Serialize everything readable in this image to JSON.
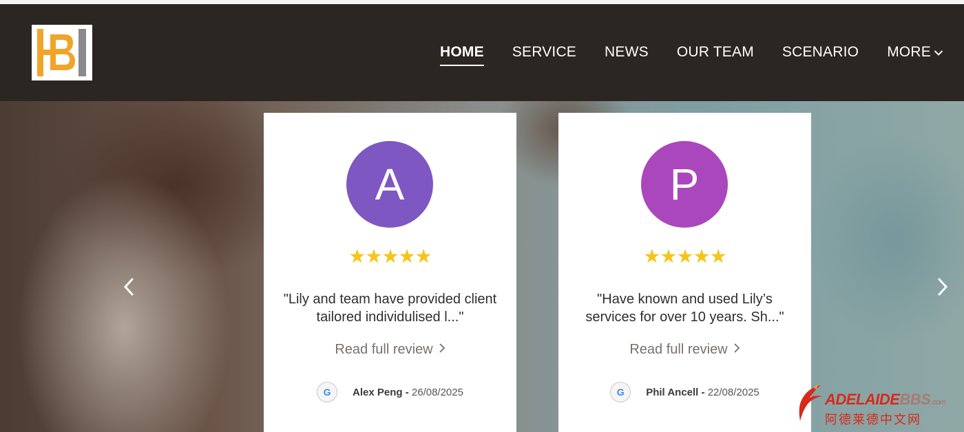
{
  "header": {
    "logo_text": "HB",
    "nav": [
      {
        "label": "HOME",
        "active": true
      },
      {
        "label": "SERVICE",
        "active": false
      },
      {
        "label": "NEWS",
        "active": false
      },
      {
        "label": "OUR TEAM",
        "active": false
      },
      {
        "label": "SCENARIO",
        "active": false
      },
      {
        "label": "MORE",
        "active": false,
        "icon": "chevron-down-icon"
      }
    ]
  },
  "carousel": {
    "prev_icon": "chevron-left-icon",
    "next_icon": "chevron-right-icon",
    "reviews": [
      {
        "avatar_letter": "A",
        "avatar_color": "#7e57c2",
        "rating": 5,
        "stars": "★★★★★",
        "quote": "\"Lily and team have provided client tailored individulised l...\"",
        "read_more": "Read full review",
        "source_icon": "google-icon",
        "source_letter": "G",
        "name": "Alex Peng",
        "separator": " - ",
        "date": "26/08/2025"
      },
      {
        "avatar_letter": "P",
        "avatar_color": "#ab47bc",
        "rating": 5,
        "stars": "★★★★★",
        "quote": "\"Have known and used Lily’s services for over 10 years. Sh...\"",
        "read_more": "Read full review",
        "source_icon": "google-icon",
        "source_letter": "G",
        "name": "Phil Ancell",
        "separator": " - ",
        "date": "22/08/2025"
      }
    ]
  },
  "watermark": {
    "main_bold": "ADELAIDE",
    "main_light": "BBS",
    "suffix": ".com",
    "subtitle": "阿德莱德中文网"
  },
  "colors": {
    "header_bg": "#2b2622",
    "star": "#f5c518",
    "logo_orange": "#f0a52a",
    "logo_gray": "#8a8a8a"
  }
}
